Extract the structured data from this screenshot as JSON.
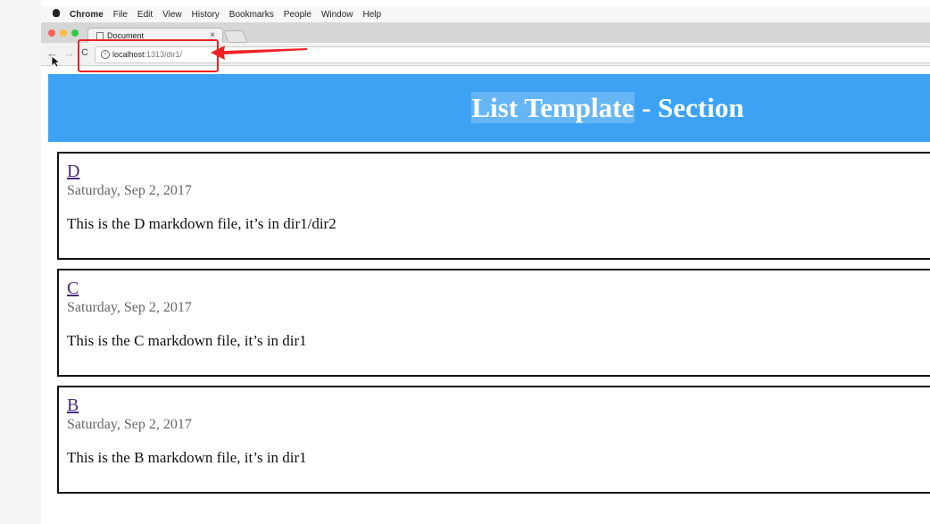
{
  "menubar": {
    "app_name": "Chrome",
    "items": [
      "File",
      "Edit",
      "View",
      "History",
      "Bookmarks",
      "People",
      "Window",
      "Help"
    ]
  },
  "tab": {
    "title": "Document",
    "close": "×"
  },
  "toolbar": {
    "back": "←",
    "forward": "→",
    "reload": "C",
    "url_host": "localhost",
    "url_path": ":1313/dir1/"
  },
  "page": {
    "title_highlight": "List Template",
    "title_rest": " - Section",
    "header_color": "#3ea2f4"
  },
  "posts": [
    {
      "title": "D",
      "date": "Saturday, Sep 2, 2017",
      "summary": "This is the D markdown file, it’s in dir1/dir2"
    },
    {
      "title": "C",
      "date": "Saturday, Sep 2, 2017",
      "summary": "This is the C markdown file, it’s in dir1"
    },
    {
      "title": "B",
      "date": "Saturday, Sep 2, 2017",
      "summary": "This is the B markdown file, it’s in dir1"
    }
  ],
  "annotation_color": "#ee2222"
}
